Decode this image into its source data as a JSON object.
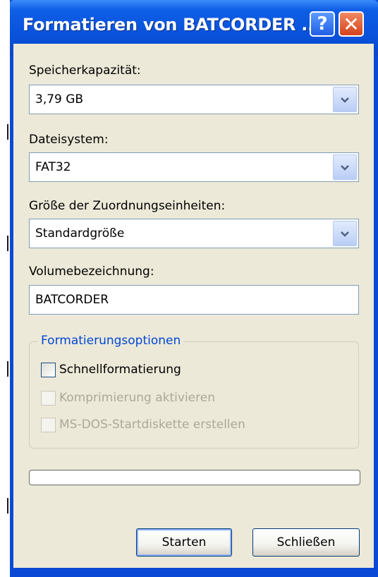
{
  "window": {
    "title": "Formatieren von BATCORDER ...",
    "help_glyph": "?",
    "close_glyph": "✕"
  },
  "capacity": {
    "label": "Speicherkapazität:",
    "value": "3,79 GB"
  },
  "filesystem": {
    "label": "Dateisystem:",
    "value": "FAT32"
  },
  "allocation": {
    "label": "Größe der Zuordnungseinheiten:",
    "value": "Standardgröße"
  },
  "volume": {
    "label": "Volumebezeichnung:",
    "value": "BATCORDER"
  },
  "options": {
    "title": "Formatierungsoptionen",
    "quick_format": {
      "label": "Schnellformatierung",
      "checked": false,
      "enabled": true
    },
    "compression": {
      "label": "Komprimierung aktivieren",
      "checked": false,
      "enabled": false
    },
    "msdos_startup": {
      "label": "MS-DOS-Startdiskette erstellen",
      "checked": false,
      "enabled": false
    }
  },
  "progress": {
    "fraction": 0
  },
  "buttons": {
    "start": "Starten",
    "close": "Schließen"
  },
  "colors": {
    "titlebar": "#0a52dc",
    "dialog_background": "#ece9d8",
    "group_title": "#0046d5",
    "disabled_text": "#aca899"
  }
}
